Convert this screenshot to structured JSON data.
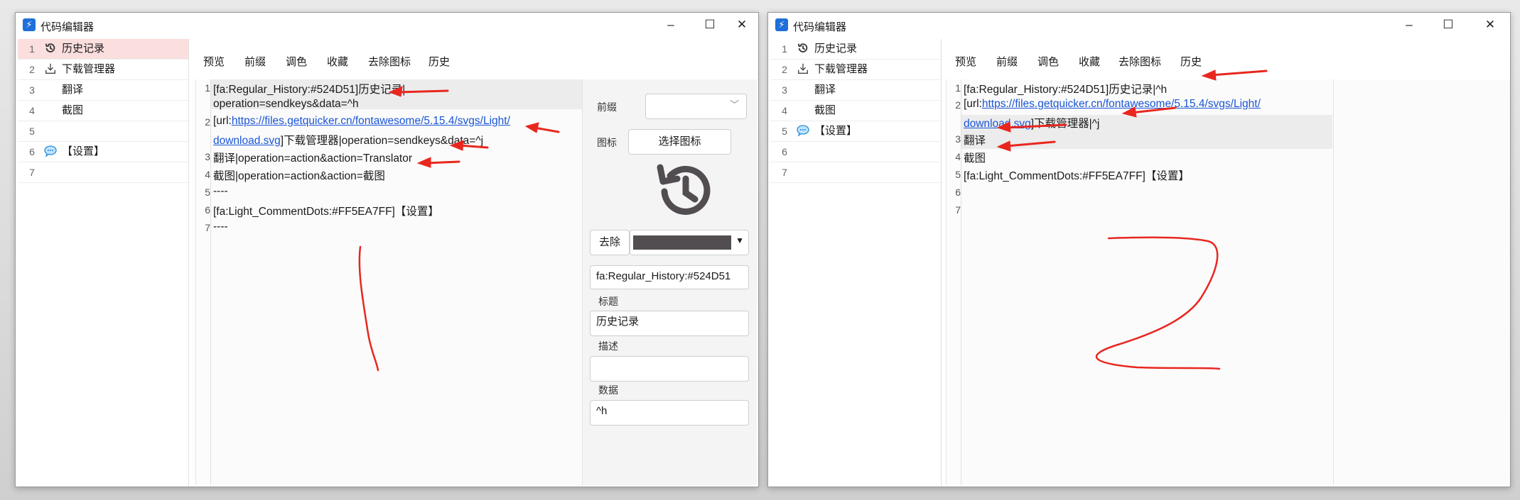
{
  "colors": {
    "accent": "#1e6fd9",
    "selected_bg": "#fbdede",
    "arrow": "#e8271f",
    "link": "#1a55d6"
  },
  "window_title": "代码编辑器",
  "window_controls": {
    "minimize": "–",
    "maximize": "☐",
    "close": "✕"
  },
  "toolbar": [
    "预览",
    "前缀",
    "调色",
    "收藏",
    "去除图标",
    "历史"
  ],
  "left": {
    "sidebar": [
      {
        "num": "1",
        "icon": "history-icon",
        "label": "历史记录"
      },
      {
        "num": "2",
        "icon": "download-icon",
        "label": "下载管理器"
      },
      {
        "num": "3",
        "icon": "",
        "label": "翻译"
      },
      {
        "num": "4",
        "icon": "",
        "label": "截图"
      },
      {
        "num": "5",
        "icon": "",
        "label": ""
      },
      {
        "num": "6",
        "icon": "comment-dots-icon",
        "label": "【设置】"
      },
      {
        "num": "7",
        "icon": "",
        "label": ""
      }
    ],
    "code": {
      "l1a": "[fa:Regular_History:#524D51]历史记录|",
      "l1b": "operation=sendkeys&data=^h",
      "l2_prefix": "[url:",
      "l2_link1": "https://files.getquicker.cn/fontawesome/5.15.4/svgs/Light/",
      "l2_link2": "download.svg",
      "l2_suffix": "]下载管理器|operation=sendkeys&data=^j",
      "l3": "翻译|operation=action&action=Translator",
      "l4": "截图|operation=action&action=截图",
      "l5": "----",
      "l6": "[fa:Light_CommentDots:#FF5EA7FF]【设置】",
      "l7": "----"
    },
    "panel": {
      "prefix_label": "前缀",
      "prefix_value": "",
      "icon_label": "图标",
      "choose_icon": "选择图标",
      "remove_label": "去除",
      "icon_value": "fa:Regular_History:#524D51",
      "title_label": "标题",
      "title_value": "历史记录",
      "desc_label": "描述",
      "desc_value": "",
      "data_label": "数据",
      "data_value": "^h"
    },
    "handwritten_number": "1"
  },
  "right": {
    "sidebar": [
      {
        "num": "1",
        "icon": "history-icon",
        "label": "历史记录"
      },
      {
        "num": "2",
        "icon": "download-icon",
        "label": "下载管理器"
      },
      {
        "num": "3",
        "icon": "",
        "label": "翻译"
      },
      {
        "num": "4",
        "icon": "",
        "label": "截图"
      },
      {
        "num": "5",
        "icon": "comment-dots-icon",
        "label": "【设置】"
      },
      {
        "num": "6",
        "icon": "",
        "label": ""
      },
      {
        "num": "7",
        "icon": "",
        "label": ""
      }
    ],
    "code": {
      "l1": "[fa:Regular_History:#524D51]历史记录|^h",
      "l2_prefix": "[url:",
      "l2_link1": "https://files.getquicker.cn/fontawesome/5.15.4/svgs/Light/",
      "l2_link2": "download.svg",
      "l2_suffix": "]下载管理器|^j",
      "l3": "翻译",
      "l4": "截图",
      "l5": "[fa:Light_CommentDots:#FF5EA7FF]【设置】"
    },
    "handwritten_number": "2"
  }
}
